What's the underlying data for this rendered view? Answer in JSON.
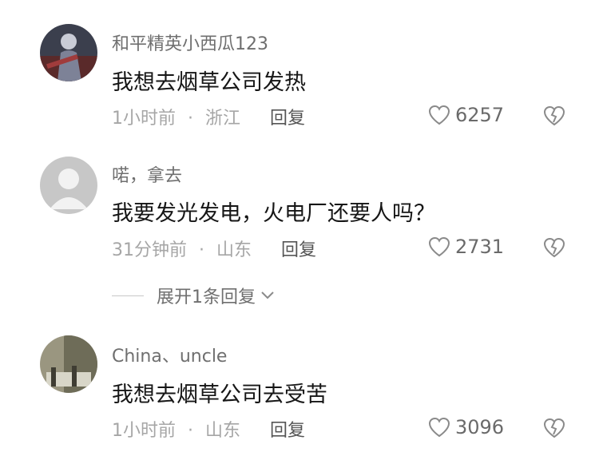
{
  "comments": [
    {
      "username": "和平精英小西瓜123",
      "text": "我想去烟草公司发热",
      "time": "1小时前",
      "separator": "·",
      "location": "浙江",
      "reply_label": "回复",
      "likes": "6257",
      "avatar_icon": "game-character-avatar"
    },
    {
      "username": "喏，拿去",
      "text": "我要发光发电，火电厂还要人吗？",
      "time": "31分钟前",
      "separator": "·",
      "location": "山东",
      "reply_label": "回复",
      "likes": "2731",
      "avatar_icon": "default-user-avatar"
    },
    {
      "username": "China、uncle",
      "text": "我想去烟草公司去受苦",
      "time": "1小时前",
      "separator": "·",
      "location": "山东",
      "reply_label": "回复",
      "likes": "3096",
      "avatar_icon": "photo-avatar"
    }
  ],
  "expand_replies": {
    "label": "展开1条回复",
    "icon": "chevron-down-icon"
  },
  "icons": {
    "like": "heart-icon",
    "dislike": "broken-heart-icon"
  },
  "colors": {
    "text": "#161616",
    "username": "#6f6f6f",
    "meta": "#a6a6a6",
    "icon": "#8a8a8a"
  }
}
